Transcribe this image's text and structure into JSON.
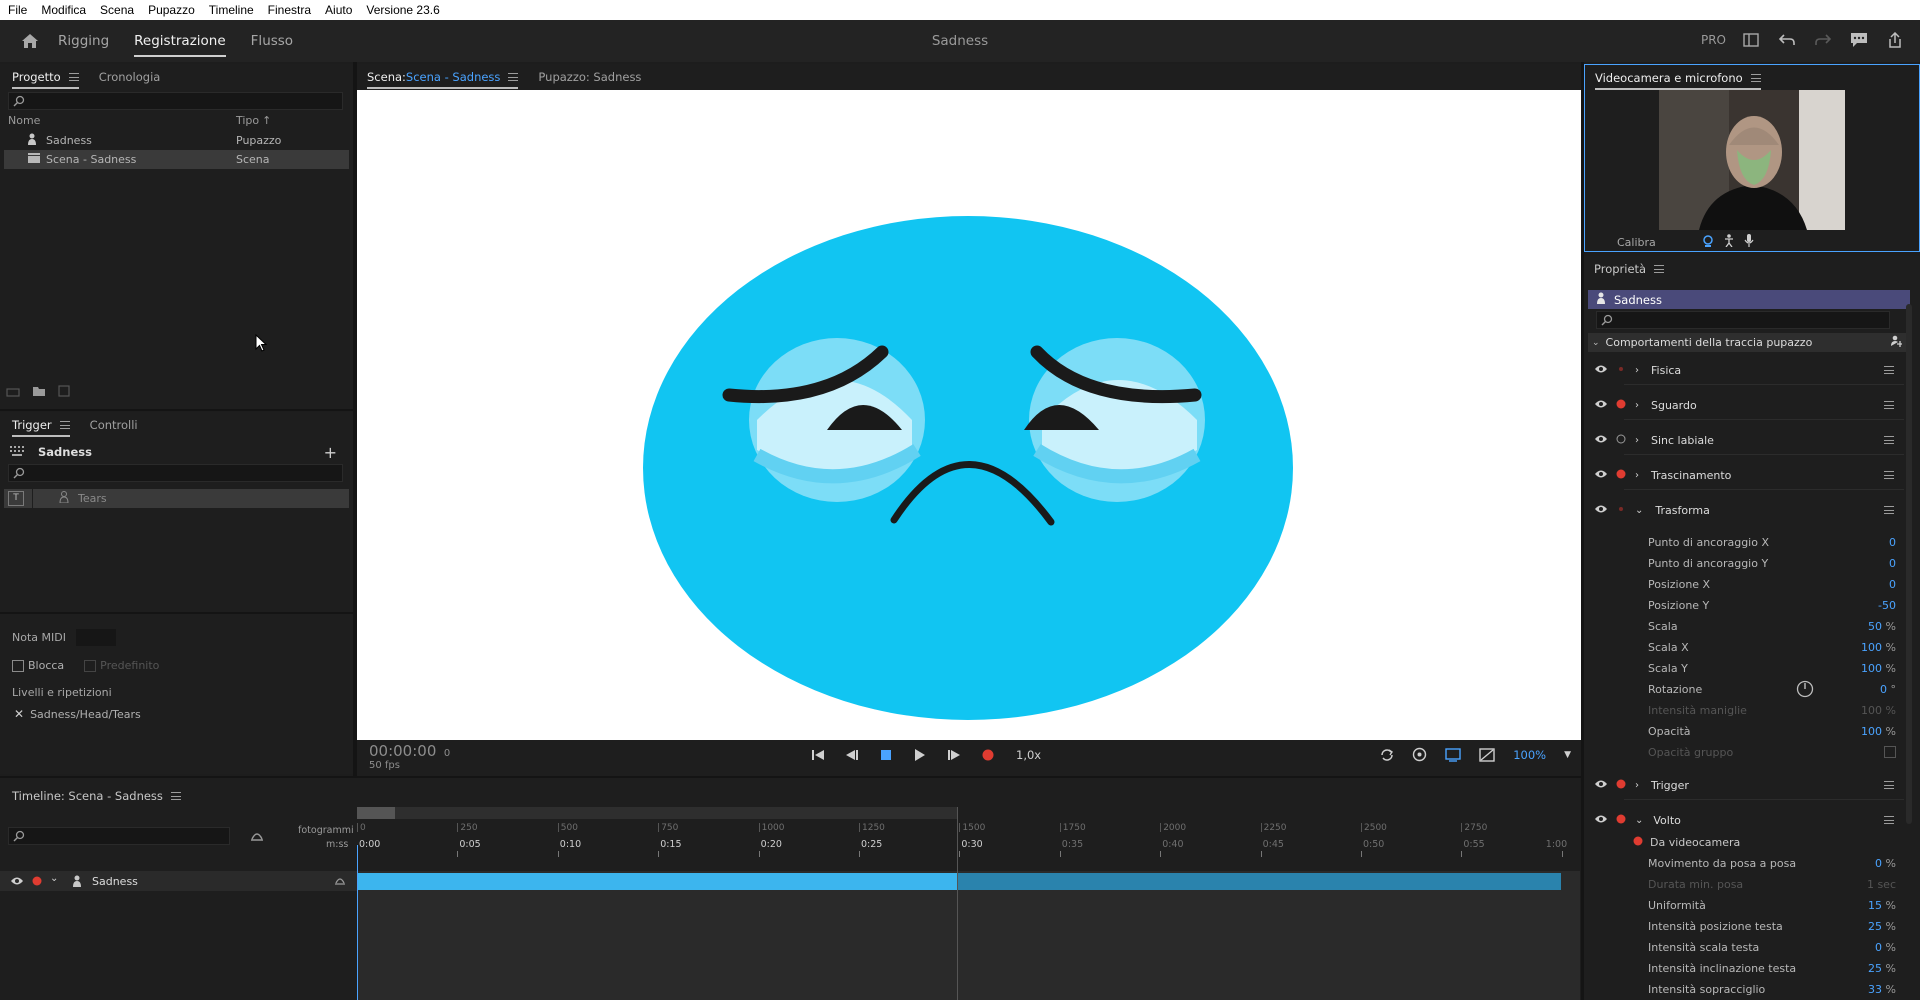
{
  "menu": [
    "File",
    "Modifica",
    "Scena",
    "Pupazzo",
    "Timeline",
    "Finestra",
    "Aiuto",
    "Versione 23.6"
  ],
  "workspace": {
    "tabs": [
      "Rigging",
      "Registrazione",
      "Flusso"
    ],
    "active_tab": "Registrazione",
    "title": "Sadness",
    "pro_label": "PRO"
  },
  "project": {
    "tabs": [
      "Progetto",
      "Cronologia"
    ],
    "columns": {
      "name": "Nome",
      "type": "Tipo"
    },
    "rows": [
      {
        "name": "Sadness",
        "type": "Pupazzo"
      },
      {
        "name": "Scena - Sadness",
        "type": "Scena"
      }
    ]
  },
  "trigger": {
    "tabs": [
      "Trigger",
      "Controlli"
    ],
    "puppet": "Sadness",
    "items": [
      {
        "key": "T",
        "name": "Tears"
      }
    ],
    "midi_label": "Nota MIDI",
    "lock_label": "Blocca",
    "default_label": "Predefinito",
    "layers_label": "Livelli e ripetizioni",
    "layer_path": "Sadness/Head/Tears"
  },
  "stage": {
    "scene_prefix": "Scena:",
    "scene_name": "Scena - Sadness",
    "puppet_tab": "Pupazzo: Sadness",
    "timecode": "00:00:00",
    "frame": "0",
    "fps": "50 fps",
    "speed": "1,0x",
    "zoom": "100%"
  },
  "camera": {
    "title": "Videocamera e microfono",
    "calibrate": "Calibra"
  },
  "properties": {
    "title": "Proprietà",
    "puppet": "Sadness",
    "behaviors_header": "Comportamenti della traccia pupazzo",
    "behaviors": [
      {
        "name": "Fisica",
        "rec": "dim"
      },
      {
        "name": "Sguardo",
        "rec": "on"
      },
      {
        "name": "Sinc labiale",
        "rec": "off"
      },
      {
        "name": "Trascinamento",
        "rec": "on"
      },
      {
        "name": "Trasforma",
        "rec": "dim"
      }
    ],
    "transform_params": [
      {
        "label": "Punto di ancoraggio X",
        "value": "0",
        "unit": "",
        "dim": false
      },
      {
        "label": "Punto di ancoraggio Y",
        "value": "0",
        "unit": "",
        "dim": false
      },
      {
        "label": "Posizione X",
        "value": "0",
        "unit": "",
        "dim": false
      },
      {
        "label": "Posizione Y",
        "value": "-50",
        "unit": "",
        "dim": false
      },
      {
        "label": "Scala",
        "value": "50",
        "unit": "%",
        "dim": false
      },
      {
        "label": "Scala X",
        "value": "100",
        "unit": "%",
        "dim": false
      },
      {
        "label": "Scala Y",
        "value": "100",
        "unit": "%",
        "dim": false
      },
      {
        "label": "Rotazione",
        "value": "0",
        "unit": "°",
        "dim": false
      },
      {
        "label": "Intensità maniglie",
        "value": "100",
        "unit": "%",
        "dim": true
      },
      {
        "label": "Opacità",
        "value": "100",
        "unit": "%",
        "dim": false
      },
      {
        "label": "Opacità gruppo",
        "value": "",
        "unit": "",
        "dim": true
      }
    ],
    "trigger_behavior": "Trigger",
    "face_behavior": "Volto",
    "face_source": "Da videocamera",
    "face_params": [
      {
        "label": "Movimento da posa a posa",
        "value": "0",
        "unit": "%",
        "dim": false
      },
      {
        "label": "Durata min. posa",
        "value": "1",
        "unit": "sec",
        "dim": true
      },
      {
        "label": "Uniformità",
        "value": "15",
        "unit": "%",
        "dim": false
      },
      {
        "label": "Intensità posizione testa",
        "value": "25",
        "unit": "%",
        "dim": false
      },
      {
        "label": "Intensità scala testa",
        "value": "0",
        "unit": "%",
        "dim": false
      },
      {
        "label": "Intensità inclinazione testa",
        "value": "25",
        "unit": "%",
        "dim": false
      },
      {
        "label": "Intensità sopracciglio",
        "value": "33",
        "unit": "%",
        "dim": false
      }
    ]
  },
  "timeline": {
    "title": "Timeline: Scena - Sadness",
    "frames_label": "fotogrammi",
    "time_label": "m:ss",
    "frame_ticks": [
      "0",
      "250",
      "500",
      "750",
      "1000",
      "1250",
      "1500",
      "1750",
      "2000",
      "2250",
      "2500",
      "2750"
    ],
    "time_ticks": [
      "0:00",
      "0:05",
      "0:10",
      "0:15",
      "0:20",
      "0:25",
      "0:30",
      "0:35",
      "0:40",
      "0:45",
      "0:50",
      "0:55",
      "1:00"
    ],
    "track_name": "Sadness"
  },
  "colors": {
    "accent": "#4aa3ff",
    "record": "#e03c31",
    "puppet_header": "#4a4a7a",
    "face": "#11c5f2",
    "track_bar": "#3cb5ee"
  }
}
